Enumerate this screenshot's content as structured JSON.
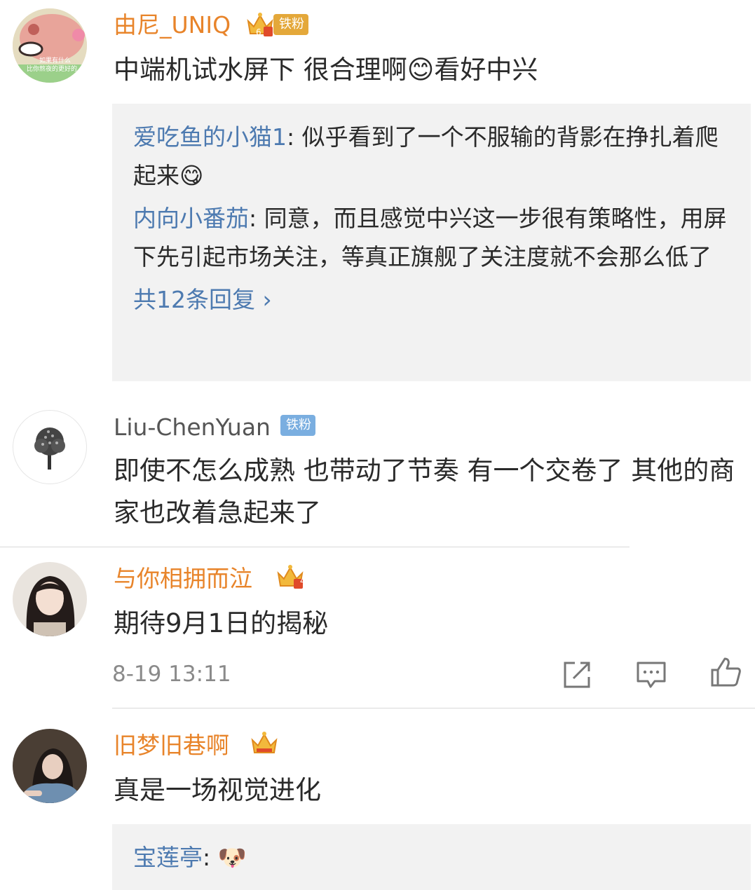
{
  "comments": [
    {
      "username": "由尼_UNIQ",
      "badge": "铁粉",
      "badge_level": "6",
      "avatar_text_1": "如果有什么",
      "avatar_text_2": "比你熬夜的更好的",
      "text": "中端机试水屏下 很合理啊😊看好中兴",
      "replies": [
        {
          "name": "爱吃鱼的小猫1",
          "text": "似乎看到了一个不服输的背影在挣扎着爬起来😋"
        },
        {
          "name": "内向小番茄",
          "text": "同意，而且感觉中兴这一步很有策略性，用屏下先引起市场关注，等真正旗舰了关注度就不会那么低了"
        }
      ],
      "more_replies": "共12条回复 ›"
    },
    {
      "username": "Liu-ChenYuan",
      "badge": "铁粉",
      "text": "即使不怎么成熟 也带动了节奏 有一个交卷了 其他的商家也改着急起来了"
    },
    {
      "username": "与你相拥而泣",
      "crown_level": "4",
      "text": "期待9月1日的揭秘",
      "timestamp": "8-19 13:11"
    },
    {
      "username": "旧梦旧巷啊",
      "text": "真是一场视觉进化",
      "replies": [
        {
          "name": "宝莲亭",
          "text": "🐶"
        }
      ]
    }
  ],
  "icons": {
    "share": "share-icon",
    "comment": "comment-icon",
    "like": "like-icon",
    "crown": "crown-icon"
  },
  "colors": {
    "username_orange": "#e8842a",
    "reply_name_blue": "#4d7ab0",
    "reply_bg": "#f2f2f2",
    "fan_badge_gold": "#e4a83a",
    "fan_badge_blue": "#7aaee0"
  }
}
